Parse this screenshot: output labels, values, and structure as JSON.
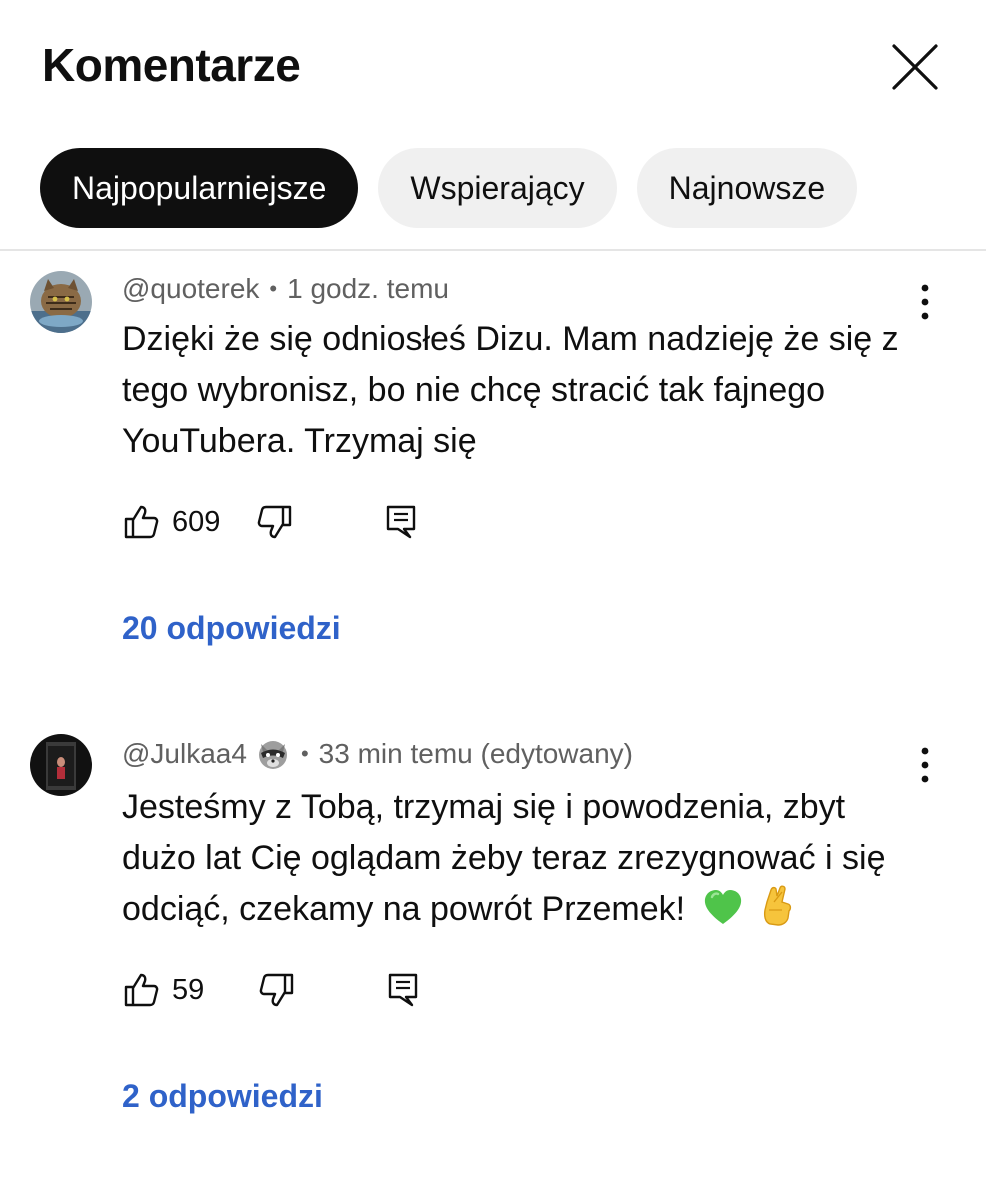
{
  "header": {
    "title": "Komentarze",
    "close_icon": "close-icon"
  },
  "filters": [
    {
      "label": "Najpopularniejsze",
      "active": true
    },
    {
      "label": "Wspierający",
      "active": false
    },
    {
      "label": "Najnowsze",
      "active": false
    }
  ],
  "comments": [
    {
      "author": "@quoterek",
      "separator": "•",
      "time": "1 godz. temu",
      "text": "Dzięki że się odniosłeś Dizu. Mam nadzieję że się z tego wybronisz, bo nie chcę stracić tak fajnego YouTubera. Trzymaj się",
      "likes": "609",
      "replies": "20 odpowiedzi"
    },
    {
      "author": "@Julkaa4",
      "badge_icon": "raccoon-badge-icon",
      "separator": "•",
      "time": "33 min temu (edytowany)",
      "text": "Jesteśmy z Tobą, trzymaj się i powodzenia, zbyt dużo lat Cię oglądam żeby teraz zrezygnować i się odciąć, czekamy na powrót Przemek!",
      "emojis": [
        "green-heart-icon",
        "crossed-fingers-icon"
      ],
      "likes": "59",
      "replies": "2 odpowiedzi"
    }
  ],
  "colors": {
    "link": "#2f62c9",
    "active_chip": "#0f0f0f",
    "chip": "#f0f0f0",
    "meta": "#606060"
  }
}
